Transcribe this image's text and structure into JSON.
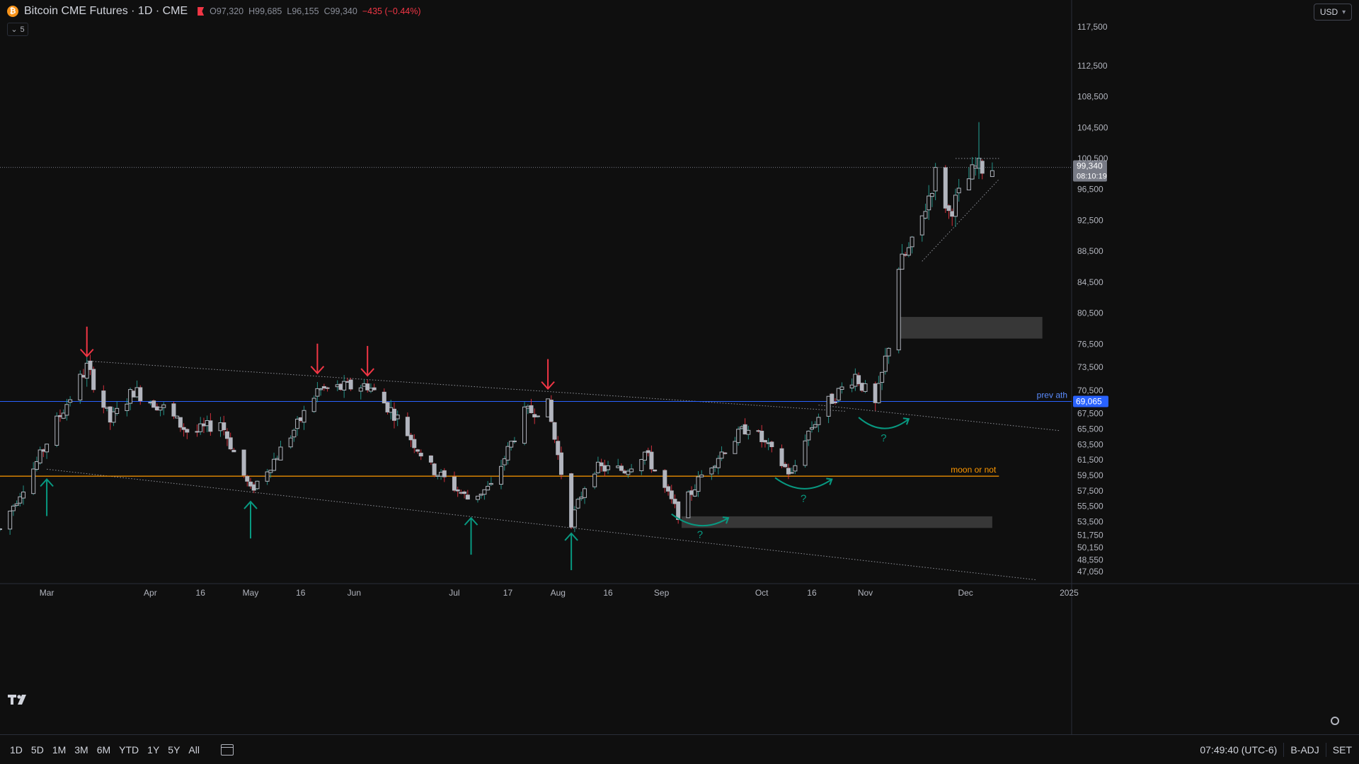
{
  "header": {
    "title": "Bitcoin CME Futures · 1D · CME",
    "open": "O97,320",
    "high": "H99,685",
    "low": "L96,155",
    "close": "C99,340",
    "change": "−435 (−0.44%)",
    "indicator_count": "5",
    "currency": "USD"
  },
  "bottom_bar": {
    "ranges": [
      "1D",
      "5D",
      "1M",
      "3M",
      "6M",
      "YTD",
      "1Y",
      "5Y",
      "All"
    ],
    "time": "07:49:40 (UTC-6)",
    "badj": "B-ADJ",
    "session": "SET"
  },
  "colors": {
    "up": "#26a69a",
    "down": "#f23645",
    "candle": "#b2b5be",
    "ath_line": "#2962ff",
    "moon_line": "#ff9800",
    "arrow_up": "#089981",
    "arrow_down": "#f23645",
    "box": "#3a3a3a"
  },
  "chart_data": {
    "type": "candlestick",
    "symbol": "Bitcoin CME Futures",
    "interval": "1D",
    "ylim": [
      45500,
      121000
    ],
    "y_ticks": [
      117500,
      112500,
      108500,
      104500,
      100500,
      96500,
      92500,
      88500,
      84500,
      80500,
      76500,
      73500,
      70500,
      67500,
      65500,
      63500,
      61500,
      59500,
      57500,
      55500,
      53500,
      51750,
      50150,
      48550,
      47050
    ],
    "y_tick_labels": [
      "117,500",
      "112,500",
      "108,500",
      "104,500",
      "100,500",
      "96,500",
      "92,500",
      "88,500",
      "84,500",
      "80,500",
      "76,500",
      "73,500",
      "70,500",
      "67,500",
      "65,500",
      "63,500",
      "61,500",
      "59,500",
      "57,500",
      "55,500",
      "53,500",
      "51,750",
      "50,150",
      "48,550",
      "47,050"
    ],
    "x_range": [
      "2024-02-16",
      "2024-12-30"
    ],
    "x_ticks": [
      {
        "date": "2024-03-01",
        "label": "Mar"
      },
      {
        "date": "2024-04-01",
        "label": "Apr"
      },
      {
        "date": "2024-04-16",
        "label": "16"
      },
      {
        "date": "2024-05-01",
        "label": "May"
      },
      {
        "date": "2024-05-16",
        "label": "16"
      },
      {
        "date": "2024-06-01",
        "label": "Jun"
      },
      {
        "date": "2024-07-01",
        "label": "Jul"
      },
      {
        "date": "2024-07-17",
        "label": "17"
      },
      {
        "date": "2024-08-01",
        "label": "Aug"
      },
      {
        "date": "2024-08-16",
        "label": "16"
      },
      {
        "date": "2024-09-01",
        "label": "Sep"
      },
      {
        "date": "2024-10-01",
        "label": "Oct"
      },
      {
        "date": "2024-10-16",
        "label": "16"
      },
      {
        "date": "2024-11-01",
        "label": "Nov"
      },
      {
        "date": "2024-12-01",
        "label": "Dec"
      },
      {
        "date": "2025-01-01",
        "label": "2025"
      }
    ],
    "ohlc_anchor_closes": [
      [
        "2024-02-16",
        52500
      ],
      [
        "2024-02-28",
        62000
      ],
      [
        "2024-03-04",
        66500
      ],
      [
        "2024-03-13",
        73500
      ],
      [
        "2024-03-20",
        66500
      ],
      [
        "2024-03-27",
        70500
      ],
      [
        "2024-04-05",
        68200
      ],
      [
        "2024-04-13",
        64800
      ],
      [
        "2024-04-22",
        66500
      ],
      [
        "2024-05-01",
        57500
      ],
      [
        "2024-05-08",
        61500
      ],
      [
        "2024-05-15",
        66000
      ],
      [
        "2024-05-21",
        70500
      ],
      [
        "2024-06-05",
        71200
      ],
      [
        "2024-06-13",
        67500
      ],
      [
        "2024-06-24",
        60500
      ],
      [
        "2024-07-05",
        56500
      ],
      [
        "2024-07-12",
        58000
      ],
      [
        "2024-07-22",
        67500
      ],
      [
        "2024-07-29",
        68500
      ],
      [
        "2024-08-05",
        53500
      ],
      [
        "2024-08-11",
        60500
      ],
      [
        "2024-08-21",
        60200
      ],
      [
        "2024-08-27",
        62500
      ],
      [
        "2024-09-06",
        54500
      ],
      [
        "2024-09-13",
        59500
      ],
      [
        "2024-09-20",
        63000
      ],
      [
        "2024-09-27",
        66000
      ],
      [
        "2024-10-10",
        59500
      ],
      [
        "2024-10-14",
        64500
      ],
      [
        "2024-10-20",
        68500
      ],
      [
        "2024-10-29",
        72500
      ],
      [
        "2024-11-04",
        68500
      ],
      [
        "2024-11-08",
        76500
      ],
      [
        "2024-11-11",
        86500
      ],
      [
        "2024-11-16",
        90000
      ],
      [
        "2024-11-22",
        98500
      ],
      [
        "2024-11-26",
        93500
      ],
      [
        "2024-12-04",
        99300
      ],
      [
        "2024-12-09",
        99340
      ]
    ],
    "last_price": {
      "value": 99340,
      "label": "99,340",
      "countdown": "08:10:19"
    },
    "levels": [
      {
        "name": "prev ath",
        "label": "prev ath",
        "value": 69065,
        "value_label": "69,065"
      },
      {
        "name": "moon or not",
        "label": "moon or not",
        "value": 59400
      }
    ],
    "trendlines": [
      {
        "from": [
          "2024-03-13",
          74300
        ],
        "to": [
          "2024-10-26",
          67800
        ]
      },
      {
        "from": [
          "2024-10-18",
          68600
        ],
        "to": [
          "2024-12-29",
          65300
        ]
      },
      {
        "from": [
          "2024-03-01",
          60300
        ],
        "to": [
          "2024-12-22",
          46000
        ]
      },
      {
        "from": [
          "2024-11-18",
          87200
        ],
        "to": [
          "2024-12-11",
          97800
        ]
      },
      {
        "from": [
          "2024-11-28",
          100500
        ],
        "to": [
          "2024-12-11",
          100500
        ]
      }
    ],
    "boxes": [
      {
        "from": [
          "2024-11-11",
          80000
        ],
        "to": [
          "2024-12-24",
          77200
        ]
      },
      {
        "from": [
          "2024-09-07",
          54200
        ],
        "to": [
          "2024-12-09",
          52700
        ]
      }
    ],
    "arrows_down": [
      [
        "2024-03-13",
        74900
      ],
      [
        "2024-05-21",
        72700
      ],
      [
        "2024-06-05",
        72400
      ],
      [
        "2024-07-29",
        70700
      ]
    ],
    "arrows_up": [
      [
        "2024-03-01",
        59000
      ],
      [
        "2024-05-01",
        56100
      ],
      [
        "2024-07-06",
        54000
      ],
      [
        "2024-08-05",
        52000
      ]
    ],
    "curve_annotations": [
      {
        "from": [
          "2024-09-04",
          54500
        ],
        "to": [
          "2024-09-21",
          54000
        ],
        "label": "?"
      },
      {
        "from": [
          "2024-10-05",
          59200
        ],
        "to": [
          "2024-10-22",
          59000
        ],
        "label": "?"
      },
      {
        "from": [
          "2024-10-30",
          67000
        ],
        "to": [
          "2024-11-14",
          66800
        ],
        "label": "?"
      }
    ]
  }
}
